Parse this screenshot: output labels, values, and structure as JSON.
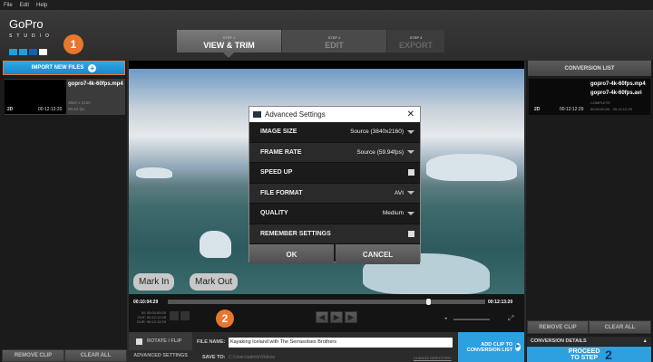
{
  "menu": [
    "File",
    "Edit",
    "Help"
  ],
  "logo": {
    "name": "GoPro",
    "sub": "STUDIO"
  },
  "annotations": {
    "badge1": "1",
    "badge2": "2",
    "mark_in": "Mark In",
    "mark_out": "Mark Out"
  },
  "steps": [
    {
      "small": "STEP 1",
      "label": "VIEW & TRIM"
    },
    {
      "small": "STEP 2",
      "label": "EDIT"
    },
    {
      "small": "STEP 3",
      "label": "EXPORT"
    }
  ],
  "left": {
    "import_label": "IMPORT NEW FILES",
    "clip": {
      "name": "gopro7-4k-60fps.mp4",
      "res": "3840 x 2160",
      "fps": "59.94 fps",
      "mode": "2D",
      "duration": "00:12:13:20"
    },
    "remove": "REMOVE CLIP",
    "clear": "CLEAR ALL"
  },
  "dialog": {
    "title": "Advanced Settings",
    "rows": [
      {
        "label": "IMAGE SIZE",
        "value": "Source (3840x2160)"
      },
      {
        "label": "FRAME RATE",
        "value": "Source (59.94fps)"
      },
      {
        "label": "SPEED UP"
      },
      {
        "label": "FILE FORMAT",
        "value": "AVI"
      },
      {
        "label": "QUALITY",
        "value": "Medium"
      },
      {
        "label": "REMEMBER SETTINGS"
      }
    ],
    "ok": "OK",
    "cancel": "CANCEL"
  },
  "timeline": {
    "current": "00:10:04:29",
    "end": "00:12:13:20",
    "in": "IN: 00:00:00:00",
    "out": "OUT: 00:12:12:29",
    "dur": "DUR: 00:12:12:29",
    "position": 0.82
  },
  "bottom": {
    "rotate": "ROTATE / FLIP",
    "advanced": "ADVANCED SETTINGS",
    "file_name_label": "FILE NAME:",
    "file_name": "Kayaking Iceland with The Serrasolses Brothers",
    "save_to_label": "SAVE TO:",
    "save_to": "C:\\Users\\admin\\Videos",
    "change_dir": "CHANGE DIRECTORY",
    "add_clip": "ADD CLIP TO CONVERSION LIST"
  },
  "right": {
    "title": "CONVERSION LIST",
    "src": "gopro7-4k-60fps.mp4",
    "dst": "gopro7-4k-60fps.avi",
    "status": "COMPLETE",
    "mode": "2D",
    "duration": "00:12:12:29",
    "range": "00:00:00:00 - 00:12:12:29",
    "remove": "REMOVE CLIP",
    "clear": "CLEAR ALL",
    "details": "CONVERSION DETAILS",
    "proceed": "PROCEED TO STEP",
    "proceed_num": "2"
  }
}
